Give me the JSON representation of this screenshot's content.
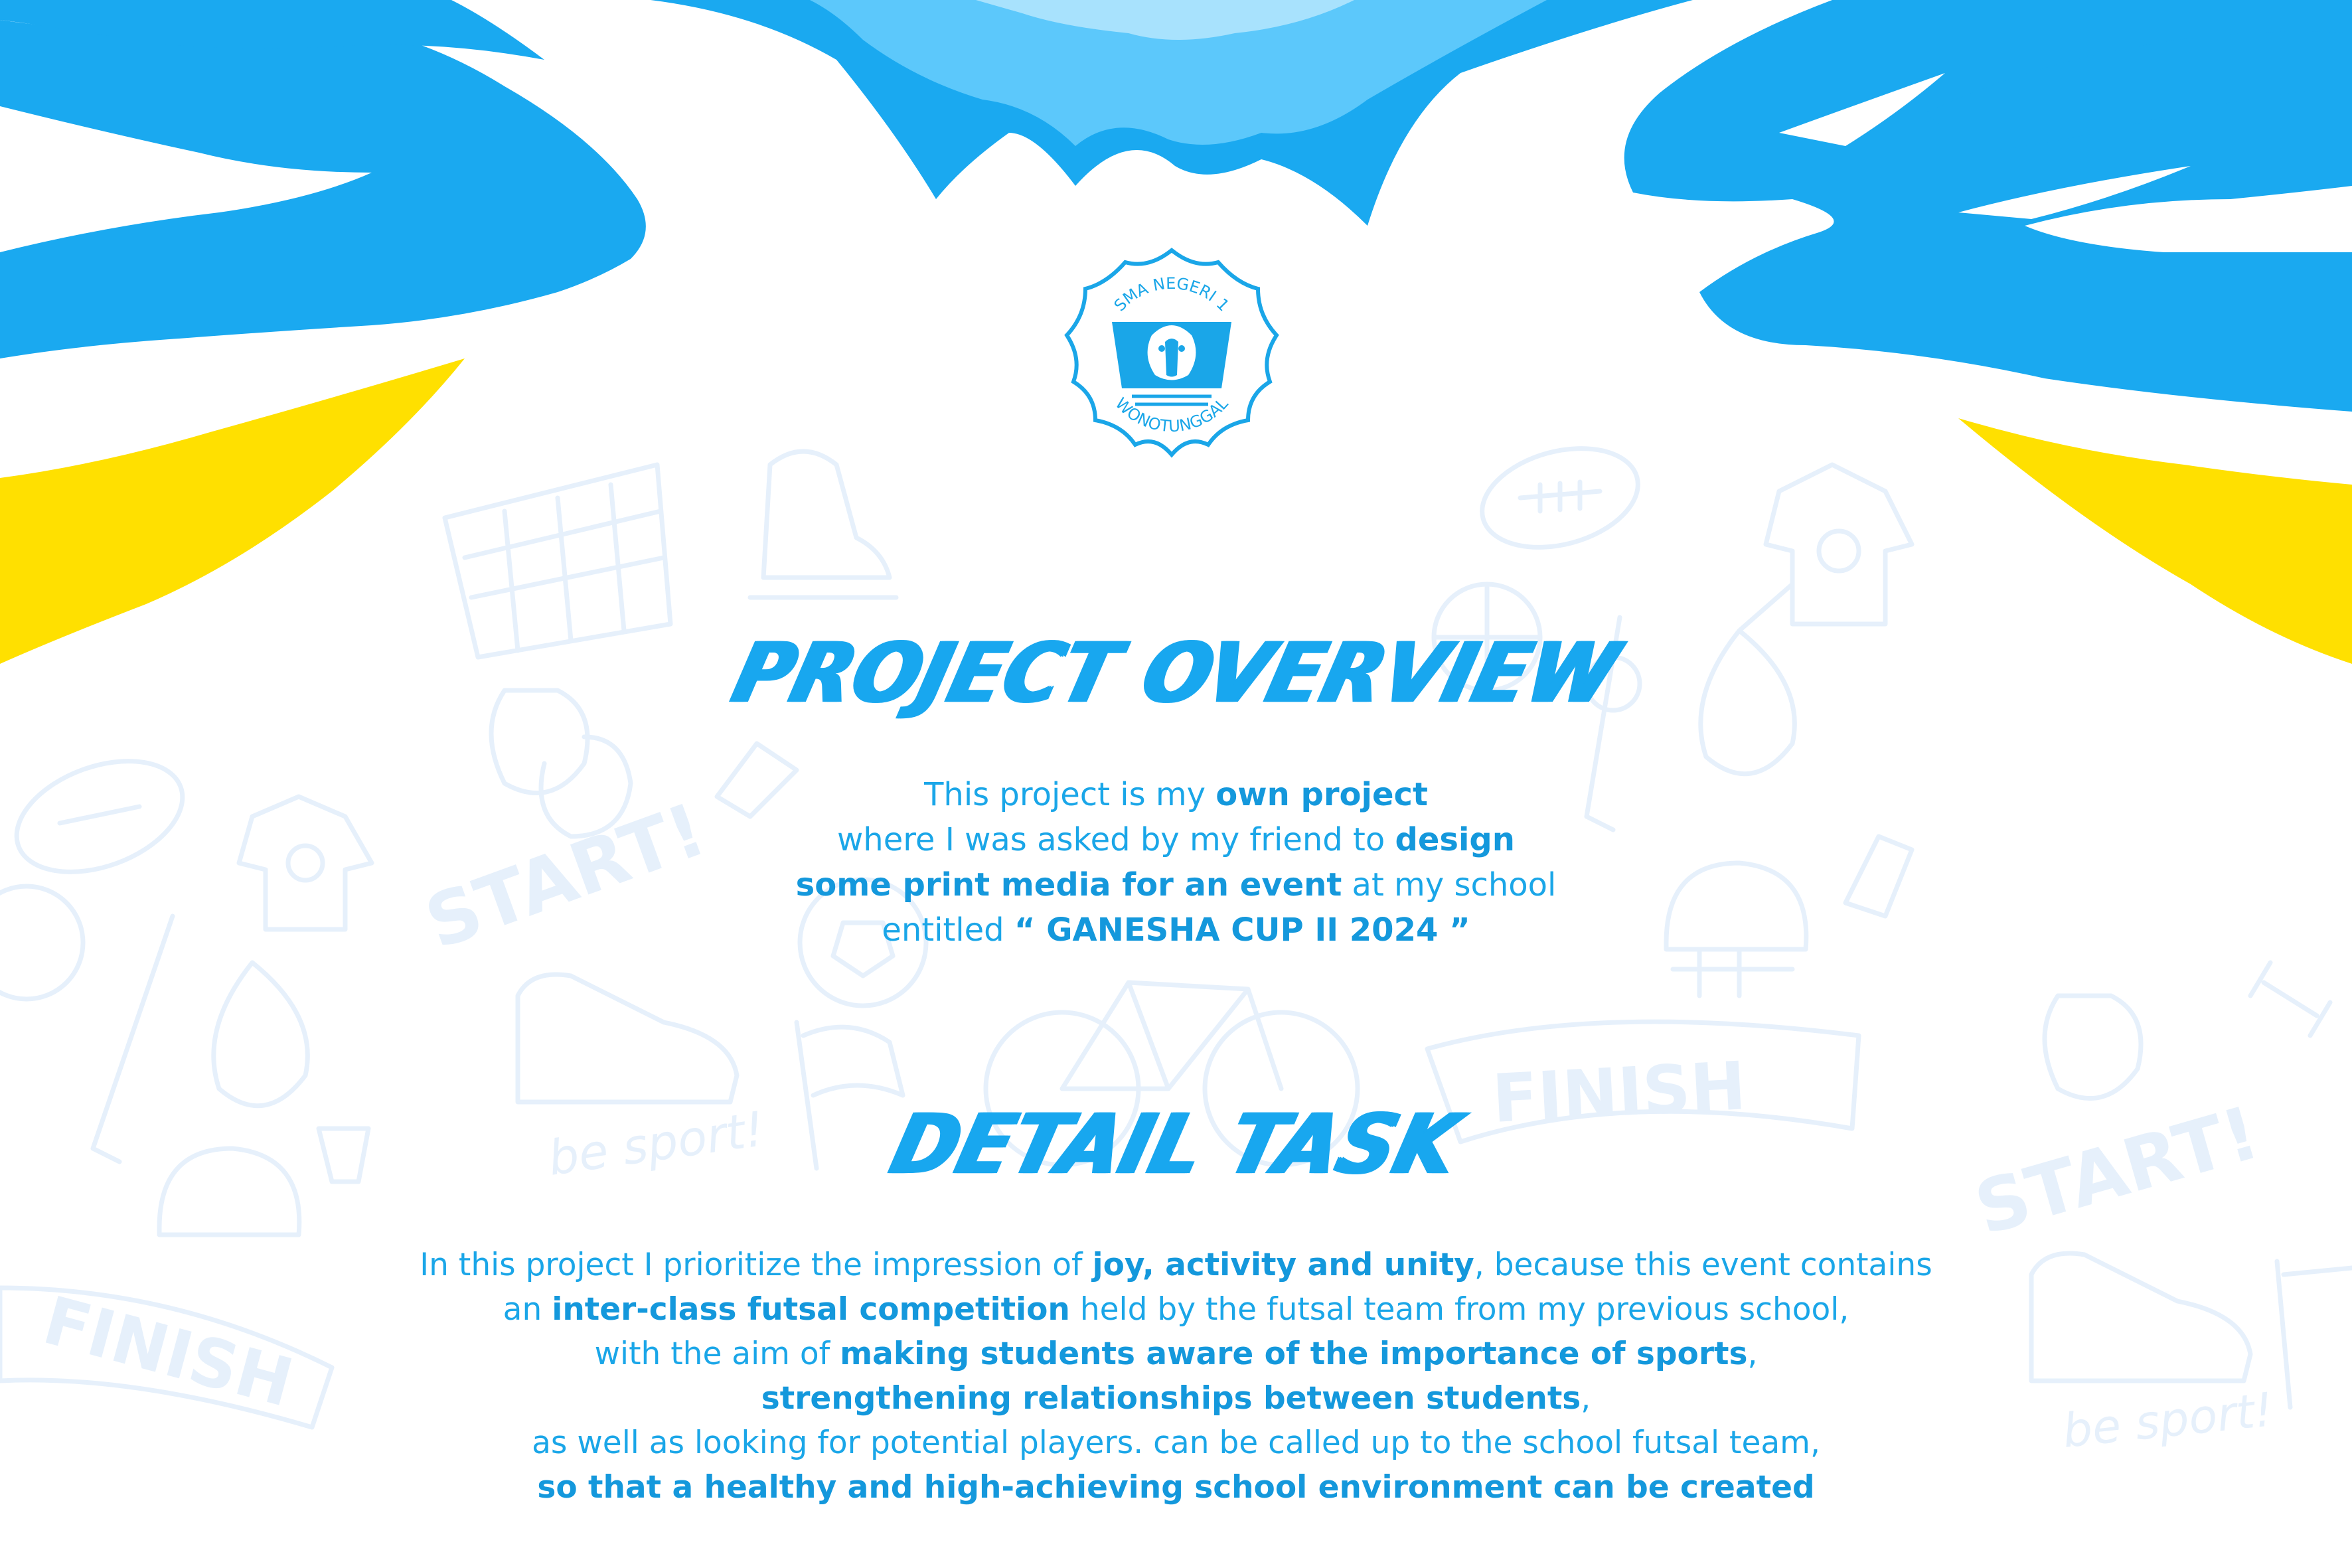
{
  "colors": {
    "sky_blue": "#1aa9f0",
    "light_blue": "#5cc8fb",
    "pale_blue": "#a8e2fd",
    "yellow": "#ffe000",
    "text_blue": "#1aa6e8",
    "doodle": "#e6f0fb"
  },
  "emblem": {
    "top_text": "SMA NEGERI 1",
    "bottom_text": "WONOTUNGGAL",
    "icon": "ganesha-emblem-icon"
  },
  "overview": {
    "heading": "PROJECT OVERVIEW",
    "lines": [
      [
        {
          "t": "This project is my "
        },
        {
          "t": "own project",
          "b": true
        }
      ],
      [
        {
          "t": "where I was asked by my friend to "
        },
        {
          "t": "design",
          "b": true
        }
      ],
      [
        {
          "t": "some print media for an event",
          "b": true
        },
        {
          "t": " at my school"
        }
      ],
      [
        {
          "t": "entitled "
        },
        {
          "t": "“ GANESHA CUP II 2024 ”",
          "b": true
        }
      ]
    ]
  },
  "detail": {
    "heading": "DETAIL TASK",
    "lines": [
      [
        {
          "t": "In this project I prioritize the impression of "
        },
        {
          "t": "joy, activity and unity",
          "b": true
        },
        {
          "t": ", because this event contains"
        }
      ],
      [
        {
          "t": "an "
        },
        {
          "t": "inter-class futsal competition",
          "b": true
        },
        {
          "t": " held by the futsal team from my previous school,"
        }
      ],
      [
        {
          "t": "with the aim of "
        },
        {
          "t": "making students aware of the importance of sports",
          "b": true
        },
        {
          "t": ","
        }
      ],
      [
        {
          "t": "strengthening relationships between students",
          "b": true
        },
        {
          "t": ","
        }
      ],
      [
        {
          "t": "as well as looking for potential players. can be called up to the school futsal team,"
        }
      ],
      [
        {
          "t": "so that a healthy and high-achieving school environment can be created",
          "b": true
        }
      ]
    ]
  },
  "doodles": {
    "words": [
      "START!",
      "FINISH",
      "be sport!",
      "START!",
      "FINISH",
      "be sport!"
    ],
    "icons": [
      "futsal-goal-icon",
      "ice-skate-icon",
      "rugby-ball-icon",
      "jersey-icon",
      "boxing-glove-icon",
      "shuttlecock-icon",
      "soccer-ball-icon",
      "bicycle-icon",
      "sneaker-icon",
      "checkered-flag-icon",
      "helmet-icon",
      "punching-bag-icon",
      "hockey-stick-icon",
      "dumbbell-icon",
      "basketball-icon"
    ]
  }
}
